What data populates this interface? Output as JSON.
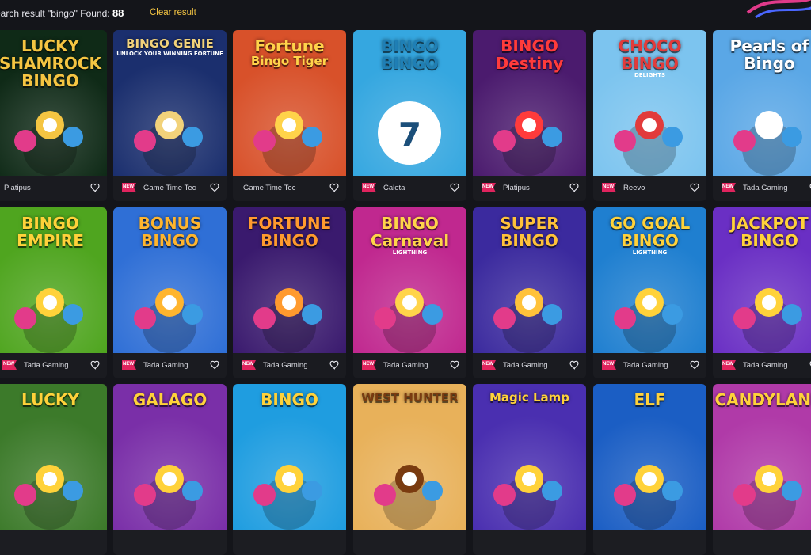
{
  "search": {
    "prefix": "earch result \"bingo\" Found: ",
    "count": "88",
    "clear_label": "Clear result"
  },
  "badge_label": "NEW",
  "rows": [
    [
      {
        "title_lines": [
          "LUCKY",
          "SHAMROCK",
          "BINGO"
        ],
        "provider": "Platipus",
        "bg": "#0f2a17",
        "accent": "#f5c542",
        "badge": false
      },
      {
        "title_lines": [
          "BINGO GENIE"
        ],
        "subtitle": "UNLOCK YOUR WINNING FORTUNE",
        "provider": "Game Time Tec",
        "bg": "#1b2f6e",
        "accent": "#f2d27a",
        "badge": true
      },
      {
        "title_lines": [
          "Fortune",
          "Bingo Tiger"
        ],
        "provider": "Game Time Tec",
        "bg": "#d8512a",
        "accent": "#ffd34a",
        "badge": false
      },
      {
        "title_lines": [
          "BINGO",
          "BINGO"
        ],
        "ball_number": "7",
        "provider": "Caleta",
        "bg": "#35a7e0",
        "accent": "#1f7fb5",
        "badge": true
      },
      {
        "title_lines": [
          "BINGO",
          "Destiny"
        ],
        "provider": "Platipus",
        "bg": "#4b1b6e",
        "accent": "#ff3b3b",
        "badge": true
      },
      {
        "title_lines": [
          "CHOCO",
          "BINGO"
        ],
        "subtitle": "DELIGHTS",
        "provider": "Reevo",
        "bg": "#7cc4ef",
        "accent": "#e23b3b",
        "badge": true
      },
      {
        "title_lines": [
          "Pearls of",
          "Bingo"
        ],
        "provider": "Tada Gaming",
        "bg": "#5aa7e6",
        "accent": "#ffffff",
        "badge": true
      }
    ],
    [
      {
        "title_lines": [
          "BINGO",
          "EMPIRE"
        ],
        "provider": "Tada Gaming",
        "bg": "#4fa51f",
        "accent": "#ffd23a",
        "badge": true
      },
      {
        "title_lines": [
          "BONUS",
          "BINGO"
        ],
        "provider": "Tada Gaming",
        "bg": "#2f6fd6",
        "accent": "#ffb52e",
        "badge": true
      },
      {
        "title_lines": [
          "FORTUNE",
          "BINGO"
        ],
        "provider": "Tada Gaming",
        "bg": "#3a1a6e",
        "accent": "#ff9a2e",
        "badge": true
      },
      {
        "title_lines": [
          "BINGO",
          "Carnaval"
        ],
        "subtitle": "LIGHTNING",
        "provider": "Tada Gaming",
        "bg": "#c0288f",
        "accent": "#ffd44a",
        "badge": true
      },
      {
        "title_lines": [
          "SUPER",
          "BINGO"
        ],
        "provider": "Tada Gaming",
        "bg": "#3b2a9e",
        "accent": "#ffc23a",
        "badge": true
      },
      {
        "title_lines": [
          "GO GOAL",
          "BINGO"
        ],
        "subtitle": "LIGHTNING",
        "provider": "Tada Gaming",
        "bg": "#1f7fd0",
        "accent": "#ffd23a",
        "badge": true
      },
      {
        "title_lines": [
          "JACKPOT",
          "BINGO"
        ],
        "provider": "Tada Gaming",
        "bg": "#6a2fc4",
        "accent": "#ffd23a",
        "badge": true
      }
    ],
    [
      {
        "title_lines": [
          "LUCKY"
        ],
        "bg": "#3c7a2a",
        "accent": "#ffd23a"
      },
      {
        "title_lines": [
          "GALAGO"
        ],
        "bg": "#7a2fa8",
        "accent": "#ffd23a"
      },
      {
        "title_lines": [
          "BINGO"
        ],
        "bg": "#1f9de0",
        "accent": "#ffd23a"
      },
      {
        "title_lines": [
          "WEST HUNTER"
        ],
        "bg": "#e8b15a",
        "accent": "#7a3b10"
      },
      {
        "title_lines": [
          "Magic Lamp"
        ],
        "bg": "#4a2fb0",
        "accent": "#ffd23a"
      },
      {
        "title_lines": [
          "ELF"
        ],
        "bg": "#1b5ec4",
        "accent": "#ffd23a"
      },
      {
        "title_lines": [
          "CANDYLAND"
        ],
        "bg": "#b03aa8",
        "accent": "#ffd23a"
      }
    ]
  ]
}
